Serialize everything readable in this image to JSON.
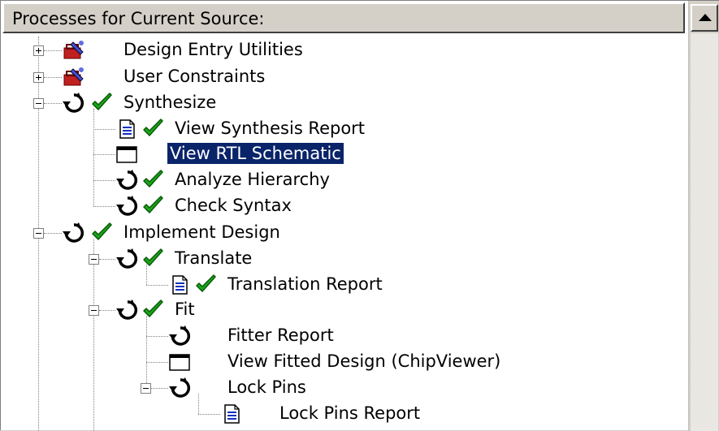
{
  "panel": {
    "header_title": "Processes for Current Source:"
  },
  "tree": {
    "items": [
      {
        "label": "Design Entry Utilities",
        "icon": "tools-icon",
        "status": "",
        "expander": "plus"
      },
      {
        "label": "User Constraints",
        "icon": "tools-icon",
        "status": "",
        "expander": "plus"
      },
      {
        "label": "Synthesize",
        "icon": "run-process-icon",
        "status": "check-icon",
        "expander": "minus"
      },
      {
        "label": "View Synthesis Report",
        "icon": "report-icon",
        "status": "check-icon",
        "expander": ""
      },
      {
        "label": "View RTL Schematic",
        "icon": "window-icon",
        "status": "",
        "expander": "",
        "selected": true
      },
      {
        "label": "Analyze Hierarchy",
        "icon": "run-process-icon",
        "status": "check-icon",
        "expander": ""
      },
      {
        "label": "Check Syntax",
        "icon": "run-process-icon",
        "status": "check-icon",
        "expander": ""
      },
      {
        "label": "Implement Design",
        "icon": "run-process-icon",
        "status": "check-icon",
        "expander": "minus"
      },
      {
        "label": "Translate",
        "icon": "run-process-icon",
        "status": "check-icon",
        "expander": "minus"
      },
      {
        "label": "Translation Report",
        "icon": "report-icon",
        "status": "check-icon",
        "expander": ""
      },
      {
        "label": "Fit",
        "icon": "run-process-icon",
        "status": "check-icon",
        "expander": "minus"
      },
      {
        "label": "Fitter Report",
        "icon": "run-process-icon",
        "status": "",
        "expander": ""
      },
      {
        "label": "View Fitted Design (ChipViewer)",
        "icon": "window-icon",
        "status": "",
        "expander": ""
      },
      {
        "label": "Lock Pins",
        "icon": "run-process-icon",
        "status": "",
        "expander": "minus"
      },
      {
        "label": "Lock Pins Report",
        "icon": "report-icon",
        "status": "",
        "expander": ""
      }
    ]
  },
  "colors": {
    "selection": "#0a246a",
    "check": "#18a818",
    "tools_red": "#c02020",
    "report_blue": "#1030c0"
  }
}
